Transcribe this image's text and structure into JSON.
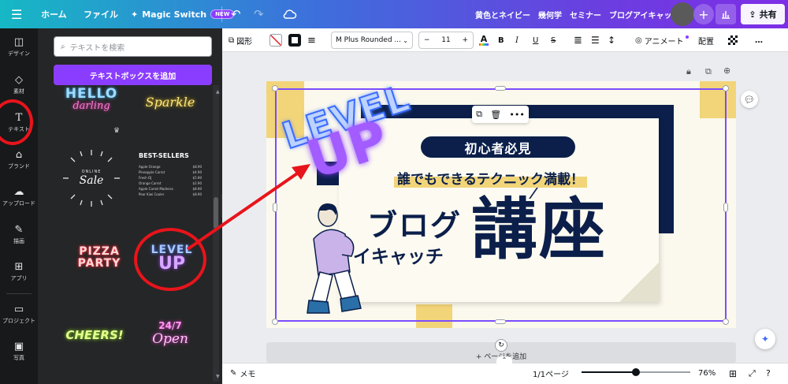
{
  "topbar": {
    "home": "ホーム",
    "file": "ファイル",
    "magic_switch": "Magic Switch",
    "new_badge": "NEW",
    "doc_title": "黄色とネイビー　幾何学　セミナー　ブログアイキャッチ",
    "share": "共有"
  },
  "sidebar": {
    "items": [
      {
        "label": "デザイン",
        "icon": "layout-icon"
      },
      {
        "label": "素材",
        "icon": "elements-icon"
      },
      {
        "label": "テキスト",
        "icon": "text-icon"
      },
      {
        "label": "ブランド",
        "icon": "brand-icon"
      },
      {
        "label": "アップロード",
        "icon": "upload-icon"
      },
      {
        "label": "描画",
        "icon": "draw-icon"
      },
      {
        "label": "アプリ",
        "icon": "apps-icon"
      },
      {
        "label": "プロジェクト",
        "icon": "folder-icon"
      },
      {
        "label": "写真",
        "icon": "photo-icon"
      }
    ]
  },
  "panel": {
    "search_placeholder": "テキストを検索",
    "add_textbox": "テキストボックスを追加",
    "tiles": {
      "hello": "HELLO",
      "darling": "darling",
      "sparkle": "Sparkle",
      "online": "ONLINE",
      "sale": "Sale",
      "bestsellers_title": "BEST-SELLERS",
      "bestsellers_rows": [
        {
          "name": "Apple Orange",
          "price": "$8.90"
        },
        {
          "name": "Pineapple Carrot",
          "price": "$4.90"
        },
        {
          "name": "Fresh OJ",
          "price": "$5.90"
        },
        {
          "name": "Orange Carrot",
          "price": "$2.90"
        },
        {
          "name": "Apple Carrot Madness",
          "price": "$8.90"
        },
        {
          "name": "Pear Kiwi Cooler",
          "price": "$8.90"
        }
      ],
      "pizza": "PIZZA",
      "party": "PARTY",
      "level": "LEVEL",
      "up": "UP",
      "cheers": "CHEERS!",
      "open": "Open",
      "open_num": "24/7"
    }
  },
  "toolbar": {
    "shapes": "図形",
    "font_name": "M Plus Rounded ...",
    "font_size": "11",
    "minus": "−",
    "plus": "+",
    "animate": "アニメート",
    "position": "配置",
    "more": "…"
  },
  "design": {
    "level": "LEVEL",
    "up": "UP",
    "beginner": "初心者必見",
    "tagline": "誰でもできるテクニック満載！",
    "blog": "ブログ",
    "eyecatch": "アイキャッチ",
    "lecture": "講座",
    "colors": {
      "navy": "#0b1f4a",
      "yellow": "#f2d579",
      "cream": "#fbf9ed",
      "purple": "#7b4dff"
    }
  },
  "canvas": {
    "add_page": "+ ページを追加"
  },
  "bottombar": {
    "notes": "メモ",
    "page_indicator": "1/1ページ",
    "zoom": "76%",
    "zoom_level": 0.5
  }
}
